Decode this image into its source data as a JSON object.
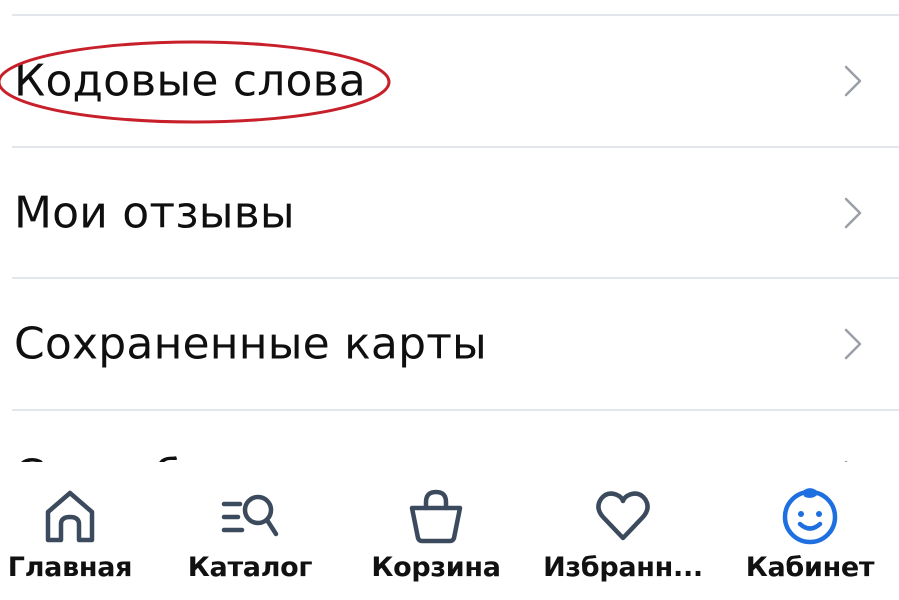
{
  "menu": {
    "items": [
      {
        "label": "Кодовые слова"
      },
      {
        "label": "Мои отзывы"
      },
      {
        "label": "Сохраненные карты"
      },
      {
        "label": "Спасибо"
      }
    ]
  },
  "annotation": {
    "color": "#c8202b",
    "shape": "oval-circle-around-first-item"
  },
  "tabbar": {
    "tabs": [
      {
        "label": "Главная",
        "icon": "home-icon"
      },
      {
        "label": "Каталог",
        "icon": "catalog-search-icon"
      },
      {
        "label": "Корзина",
        "icon": "basket-icon"
      },
      {
        "label": "Избранн...",
        "icon": "heart-icon"
      },
      {
        "label": "Кабинет",
        "icon": "profile-face-icon",
        "active": true
      }
    ],
    "icon_color": "#3b4a5c",
    "active_color": "#1e6fe0"
  }
}
